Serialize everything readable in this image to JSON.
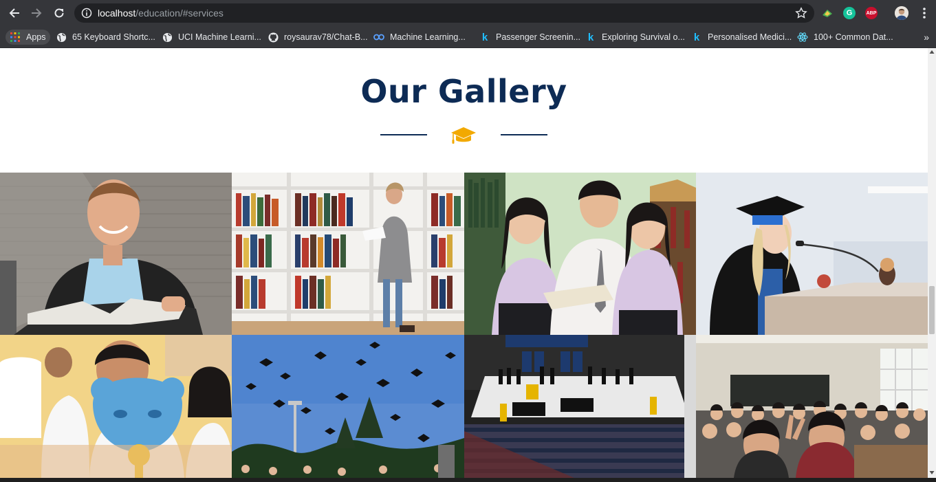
{
  "browser": {
    "url_host": "localhost",
    "url_path": "/education/#services",
    "bookmarks": [
      {
        "label": "Apps",
        "icon": "apps-grid-icon"
      },
      {
        "label": "65 Keyboard Shortc...",
        "icon": "globe-icon"
      },
      {
        "label": "UCI Machine Learni...",
        "icon": "globe-icon"
      },
      {
        "label": "roysaurav78/Chat-B...",
        "icon": "github-icon"
      },
      {
        "label": "Machine Learning...",
        "icon": "coursera-icon"
      },
      {
        "label": "Passenger Screenin...",
        "icon": "kaggle-icon"
      },
      {
        "label": "Exploring Survival o...",
        "icon": "kaggle-icon"
      },
      {
        "label": "Personalised Medici...",
        "icon": "kaggle-icon"
      },
      {
        "label": "100+ Common Dat...",
        "icon": "react-icon"
      }
    ],
    "extensions": {
      "grammarly": "G",
      "adblock": "ABP"
    },
    "more_bookmarks": "»"
  },
  "page": {
    "gallery_title": "Our Gallery",
    "divider_icon": "graduation-cap-icon",
    "accent_color": "#f2a900",
    "title_color": "#0d2b55",
    "gallery": [
      {
        "name": "gallery-image-student-reading",
        "subject": "student with book"
      },
      {
        "name": "gallery-image-library-shelves",
        "subject": "library bookshelves"
      },
      {
        "name": "gallery-image-students-group",
        "subject": "three students reading"
      },
      {
        "name": "gallery-image-graduate-speech",
        "subject": "graduate at podium"
      },
      {
        "name": "gallery-image-kids-classroom",
        "subject": "children in classroom"
      },
      {
        "name": "gallery-image-caps-toss",
        "subject": "graduation caps in sky"
      },
      {
        "name": "gallery-image-ceremony-hall",
        "subject": "graduation ceremony"
      },
      {
        "name": "gallery-image-class-photo",
        "subject": "classroom of students"
      }
    ]
  }
}
